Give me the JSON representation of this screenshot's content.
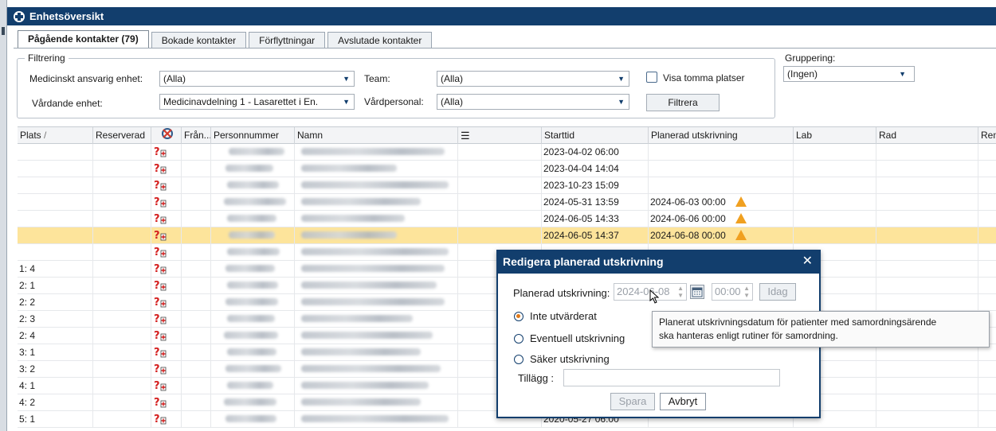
{
  "window": {
    "title": "Enhetsöversikt"
  },
  "tabs": [
    {
      "label": "Pågående kontakter (79)",
      "active": true
    },
    {
      "label": "Bokade kontakter"
    },
    {
      "label": "Förflyttningar"
    },
    {
      "label": "Avslutade kontakter"
    }
  ],
  "filter": {
    "legend": "Filtrering",
    "med_label": "Medicinskt ansvarig enhet:",
    "med_value": "(Alla)",
    "vard_label": "Vårdande enhet:",
    "vard_value": "Medicinavdelning 1 - Lasarettet i En.",
    "team_label": "Team:",
    "team_value": "(Alla)",
    "personal_label": "Vårdpersonal:",
    "personal_value": "(Alla)",
    "visa_label": "Visa tomma platser",
    "filtrera_label": "Filtrera"
  },
  "grouping": {
    "label": "Gruppering:",
    "value": "(Ingen)"
  },
  "grid": {
    "headers": {
      "plats": "Plats",
      "reserverad": "Reserverad",
      "fran": "Från...",
      "personnummer": "Personnummer",
      "namn": "Namn",
      "starttid": "Starttid",
      "planerad": "Planerad utskrivning",
      "lab": "Lab",
      "rad": "Rad",
      "remiss": "Remiss"
    },
    "rows": [
      {
        "plats": "",
        "starttid": "2023-04-02 06:00",
        "planerad": "",
        "warn": false
      },
      {
        "plats": "",
        "starttid": "2023-04-04 14:04",
        "planerad": "",
        "warn": false
      },
      {
        "plats": "",
        "starttid": "2023-10-23 15:09",
        "planerad": "",
        "warn": false
      },
      {
        "plats": "",
        "starttid": "2024-05-31 13:59",
        "planerad": "2024-06-03 00:00",
        "warn": true
      },
      {
        "plats": "",
        "starttid": "2024-06-05 14:33",
        "planerad": "2024-06-06 00:00",
        "warn": true
      },
      {
        "plats": "",
        "starttid": "2024-06-05 14:37",
        "planerad": "2024-06-08 00:00",
        "warn": true,
        "selected": true
      },
      {
        "plats": "",
        "starttid": "",
        "planerad": "",
        "warn": false
      },
      {
        "plats": "1: 4",
        "starttid": "",
        "planerad": "",
        "warn": false
      },
      {
        "plats": "2: 1",
        "starttid": "",
        "planerad": "",
        "warn": false
      },
      {
        "plats": "2: 2",
        "starttid": "",
        "planerad": "",
        "warn": false
      },
      {
        "plats": "2: 3",
        "starttid": "",
        "planerad": "",
        "warn": false
      },
      {
        "plats": "2: 4",
        "starttid": "",
        "planerad": "",
        "warn": false
      },
      {
        "plats": "3: 1",
        "starttid": "",
        "planerad": "",
        "warn": false
      },
      {
        "plats": "3: 2",
        "starttid": "",
        "planerad": "",
        "warn": false
      },
      {
        "plats": "4: 1",
        "starttid": "",
        "planerad": "",
        "warn": false
      },
      {
        "plats": "4: 2",
        "starttid": "",
        "planerad": "",
        "warn": false
      },
      {
        "plats": "5: 1",
        "starttid": "2020-05-27 06:00",
        "planerad": "",
        "warn": false
      }
    ]
  },
  "dialog": {
    "title": "Redigera planerad utskrivning",
    "planerad_label": "Planerad utskrivning:",
    "date_value": "2024-06-08",
    "time_value": "00:00",
    "idag_label": "Idag",
    "radio_inte": "Inte utvärderat",
    "radio_eventuell": "Eventuell utskrivning",
    "radio_saker": "Säker utskrivning",
    "tillagg_label": "Tillägg :",
    "tillagg_value": "",
    "spara_label": "Spara",
    "avbryt_label": "Avbryt"
  },
  "tooltip": {
    "line1": "Planerat utskrivningsdatum för patienter med samordningsärende",
    "line2": "ska hanteras enligt rutiner för samordning."
  },
  "colors": {
    "titlebar": "#123e6d",
    "selected_row": "#fde49b",
    "warning": "#f0a020"
  }
}
